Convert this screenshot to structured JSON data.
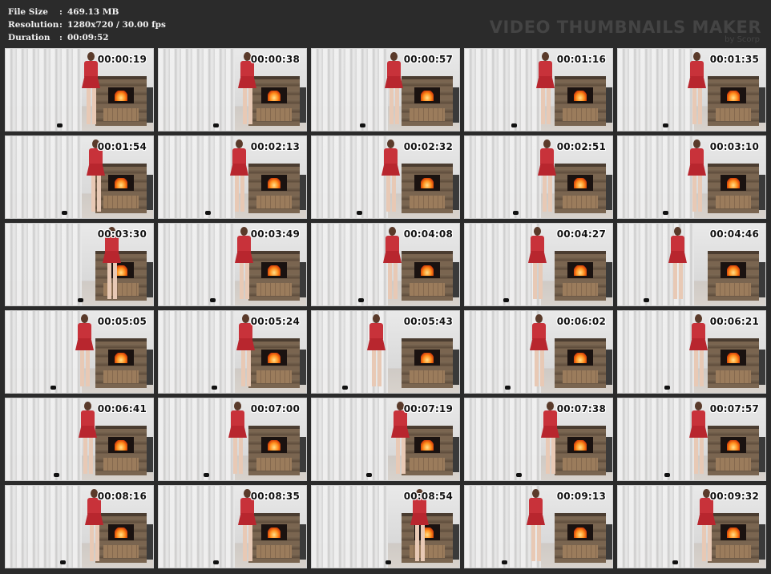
{
  "header": {
    "file_size_label": "File Size",
    "file_size_value": "469.13 MB",
    "resolution_label": "Resolution",
    "resolution_value": "1280x720 / 30.00 fps",
    "duration_label": "Duration",
    "duration_value": "00:09:52",
    "colon": ":",
    "brand_title": "VIDEO THUMBNAILS MAKER",
    "brand_sub": "by Scorp"
  },
  "thumbnails": [
    {
      "time": "00:00:19"
    },
    {
      "time": "00:00:38"
    },
    {
      "time": "00:00:57"
    },
    {
      "time": "00:01:16"
    },
    {
      "time": "00:01:35"
    },
    {
      "time": "00:01:54"
    },
    {
      "time": "00:02:13"
    },
    {
      "time": "00:02:32"
    },
    {
      "time": "00:02:51"
    },
    {
      "time": "00:03:10"
    },
    {
      "time": "00:03:30"
    },
    {
      "time": "00:03:49"
    },
    {
      "time": "00:04:08"
    },
    {
      "time": "00:04:27"
    },
    {
      "time": "00:04:46"
    },
    {
      "time": "00:05:05"
    },
    {
      "time": "00:05:24"
    },
    {
      "time": "00:05:43"
    },
    {
      "time": "00:06:02"
    },
    {
      "time": "00:06:21"
    },
    {
      "time": "00:06:41"
    },
    {
      "time": "00:07:00"
    },
    {
      "time": "00:07:19"
    },
    {
      "time": "00:07:38"
    },
    {
      "time": "00:07:57"
    },
    {
      "time": "00:08:16"
    },
    {
      "time": "00:08:35"
    },
    {
      "time": "00:08:54"
    },
    {
      "time": "00:09:13"
    },
    {
      "time": "00:09:32"
    }
  ],
  "colors": {
    "background": "#2b2b2b",
    "header_text": "#f2f2f2",
    "brand_text": "#444444",
    "dress": "#c8323a"
  }
}
